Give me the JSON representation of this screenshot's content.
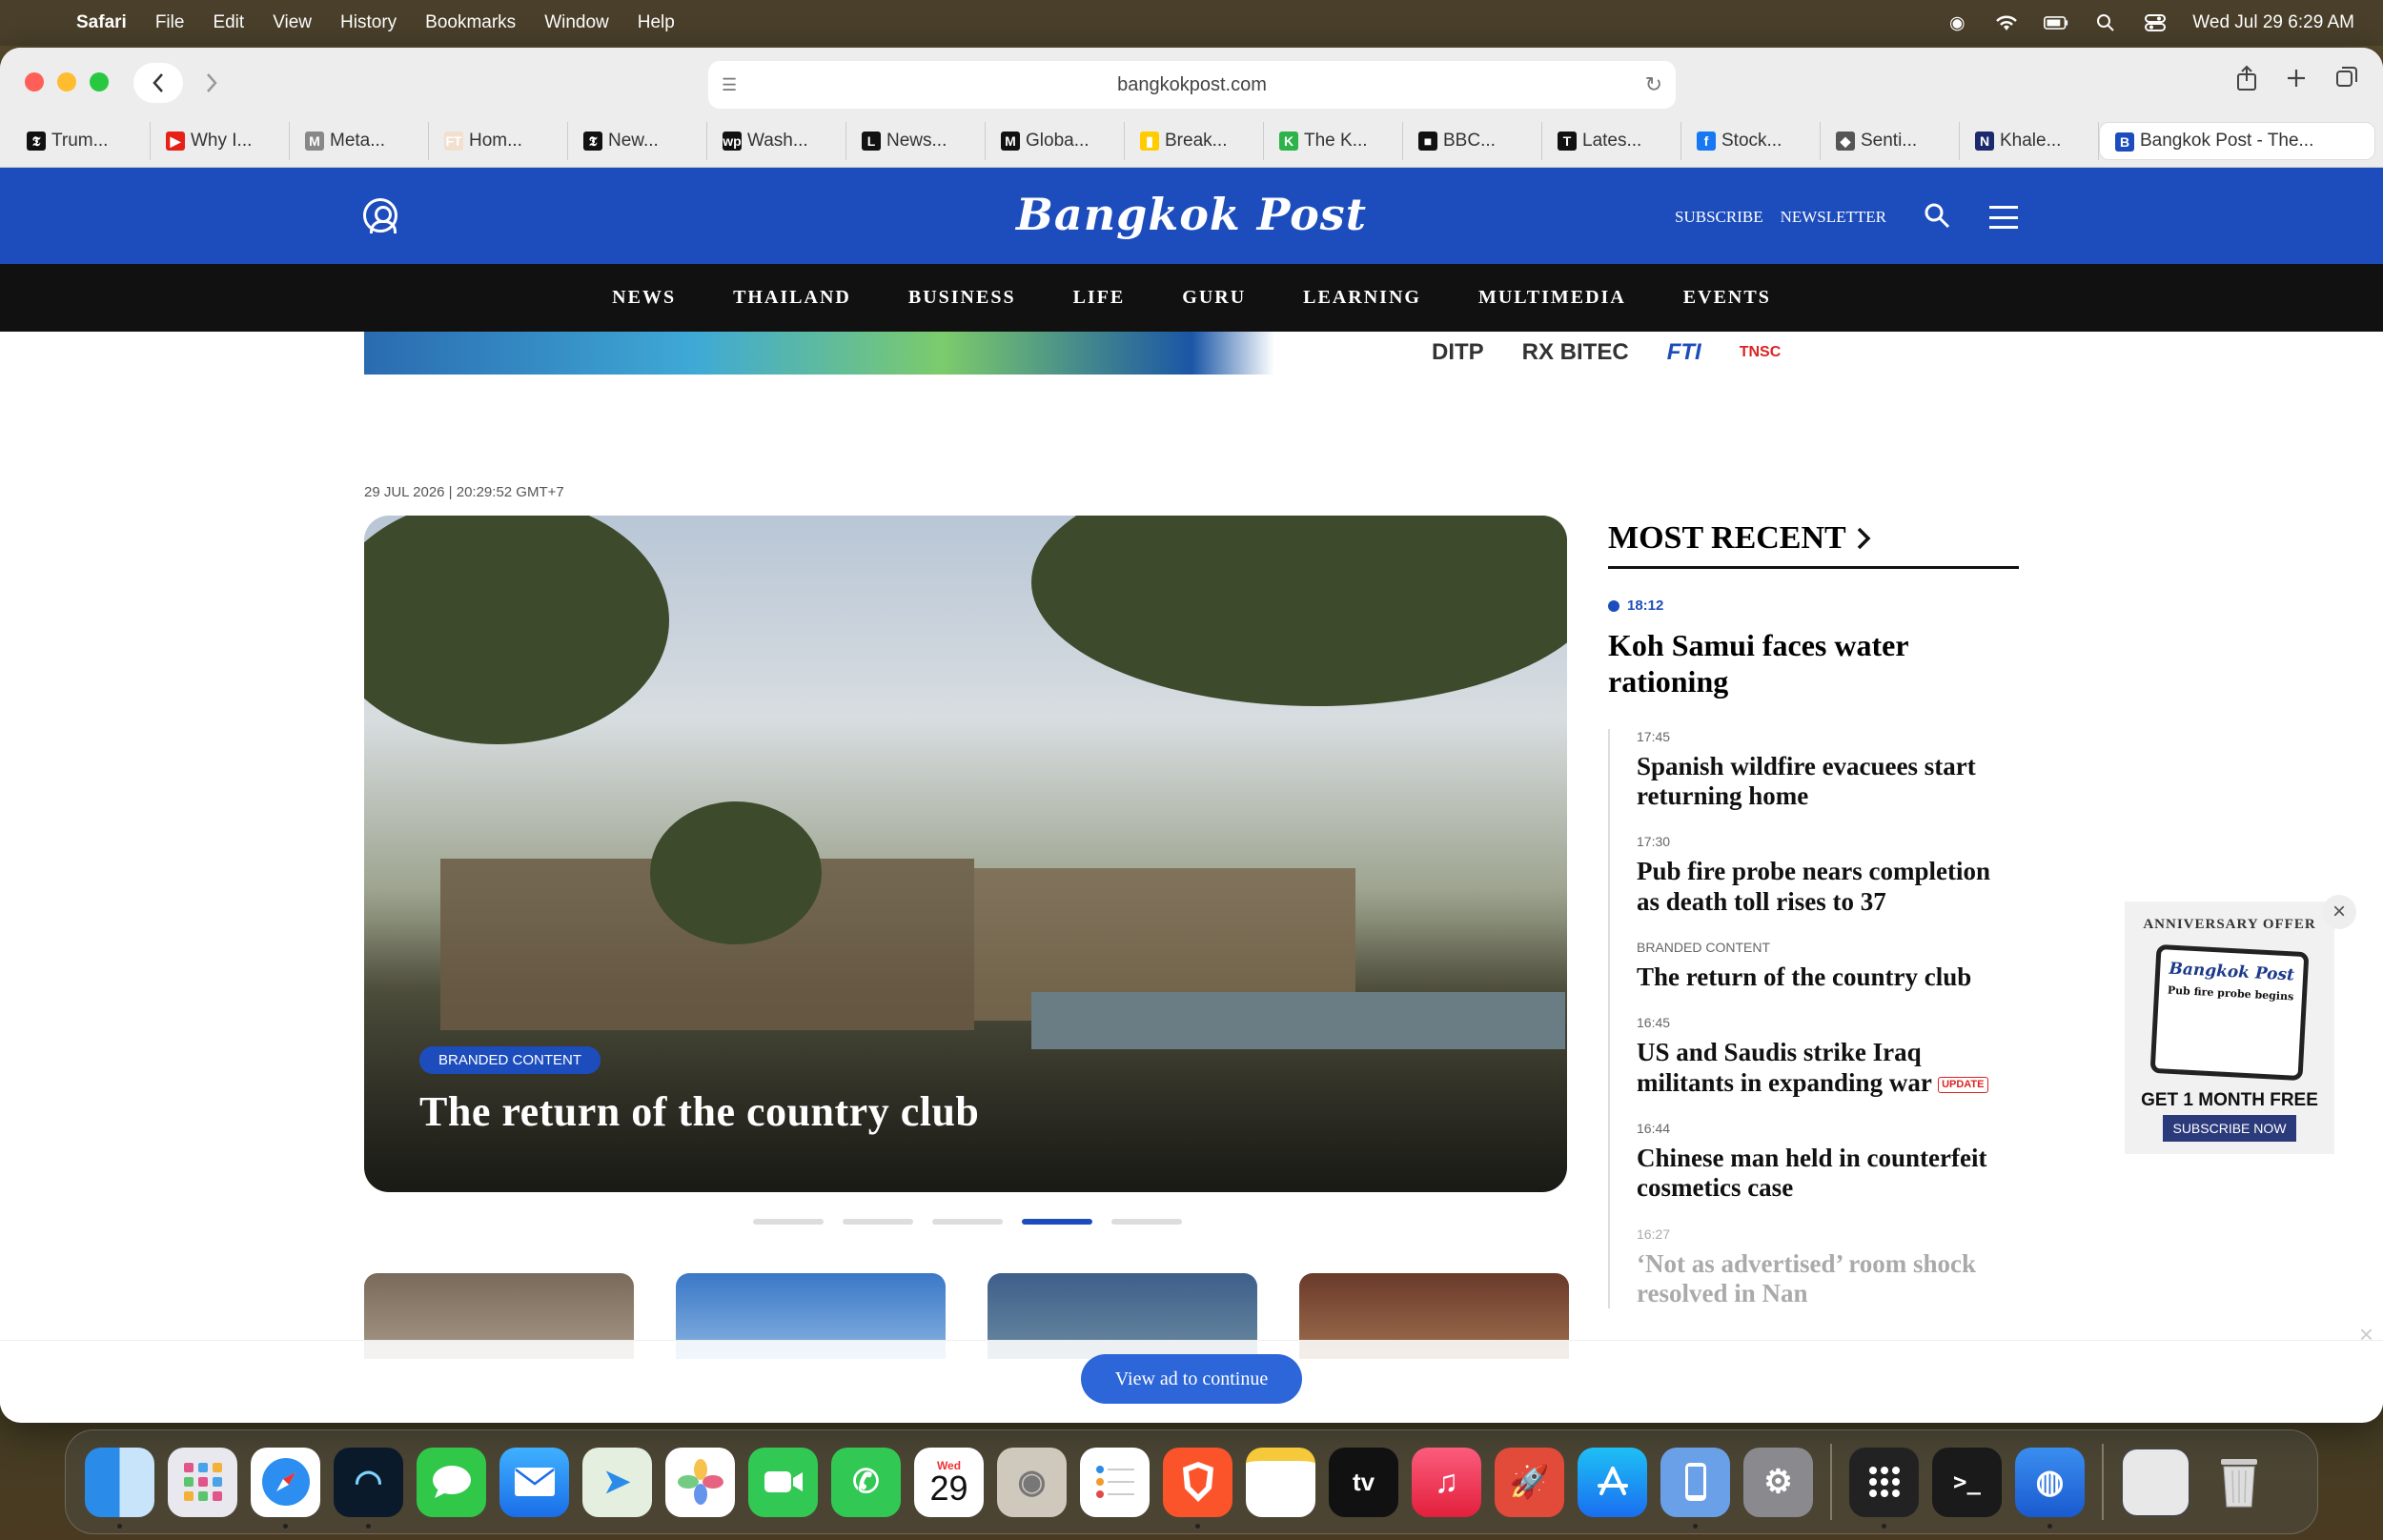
{
  "menubar": {
    "app": "Safari",
    "items": [
      "File",
      "Edit",
      "View",
      "History",
      "Bookmarks",
      "Window",
      "Help"
    ],
    "clock": "Wed Jul 29  6:29 AM"
  },
  "browser": {
    "url": "bangkokpost.com",
    "tabs": [
      {
        "label": "Trum...",
        "fav": "𝕿",
        "color": "#111"
      },
      {
        "label": "Why I...",
        "fav": "▶",
        "color": "#e62117"
      },
      {
        "label": "Meta...",
        "fav": "M",
        "color": "#888"
      },
      {
        "label": "Hom...",
        "fav": "FT",
        "color": "#f2dfce"
      },
      {
        "label": "New...",
        "fav": "𝕿",
        "color": "#111"
      },
      {
        "label": "Wash...",
        "fav": "wp",
        "color": "#111"
      },
      {
        "label": "News...",
        "fav": "L",
        "color": "#111"
      },
      {
        "label": "Globa...",
        "fav": "M",
        "color": "#111"
      },
      {
        "label": "Break...",
        "fav": "▮",
        "color": "#ffcc00"
      },
      {
        "label": "The K...",
        "fav": "K",
        "color": "#2db34a"
      },
      {
        "label": "BBC...",
        "fav": "■",
        "color": "#111"
      },
      {
        "label": "Lates...",
        "fav": "T",
        "color": "#111"
      },
      {
        "label": "Stock...",
        "fav": "f",
        "color": "#1877f2"
      },
      {
        "label": "Senti...",
        "fav": "◆",
        "color": "#555"
      },
      {
        "label": "Khale...",
        "fav": "N",
        "color": "#1a2a6c"
      }
    ],
    "active_tab": {
      "label": "Bangkok Post - The...",
      "fav": "B",
      "color": "#1d4dbd"
    }
  },
  "site": {
    "logo": "Bangkok Post",
    "header_links": [
      "SUBSCRIBE",
      "NEWSLETTER"
    ],
    "nav": [
      "NEWS",
      "THAILAND",
      "BUSINESS",
      "LIFE",
      "GURU",
      "LEARNING",
      "MULTIMEDIA",
      "EVENTS"
    ],
    "ad_logos": [
      "DITP",
      "RX BITEC",
      "FTI",
      "TNSC"
    ],
    "timestamp": "29 JUL 2026 | 20:29:52 GMT+7",
    "hero": {
      "badge": "BRANDED CONTENT",
      "title": "The return of the country club",
      "slide_count": 5,
      "active_slide": 4
    },
    "most_recent": {
      "heading": "MOST RECENT",
      "top": {
        "time": "18:12",
        "headline": "Koh Samui faces water rationing"
      },
      "items": [
        {
          "time": "17:45",
          "headline": "Spanish wildfire evacuees start returning home"
        },
        {
          "time": "17:30",
          "headline": "Pub fire probe nears completion as death toll rises to 37"
        },
        {
          "time": "BRANDED CONTENT",
          "headline": "The return of the country club"
        },
        {
          "time": "16:45",
          "headline": "US and Saudis strike Iraq militants in expanding war",
          "tag": "UPDATE"
        },
        {
          "time": "16:44",
          "headline": "Chinese man held in counterfeit cosmetics case"
        },
        {
          "time": "16:27",
          "headline": "‘Not as advertised’ room shock resolved in Nan"
        }
      ]
    },
    "anniversary": {
      "label": "ANNIVERSARY OFFER",
      "tablet_logo": "Bangkok Post",
      "tablet_headline": "Pub fire probe begins",
      "free": "GET 1 MONTH FREE",
      "button": "SUBSCRIBE NOW"
    },
    "overlay_button": "View ad to continue"
  },
  "dock": {
    "calendar_day": "Wed",
    "calendar_date": "29",
    "tv_label": "tv"
  }
}
